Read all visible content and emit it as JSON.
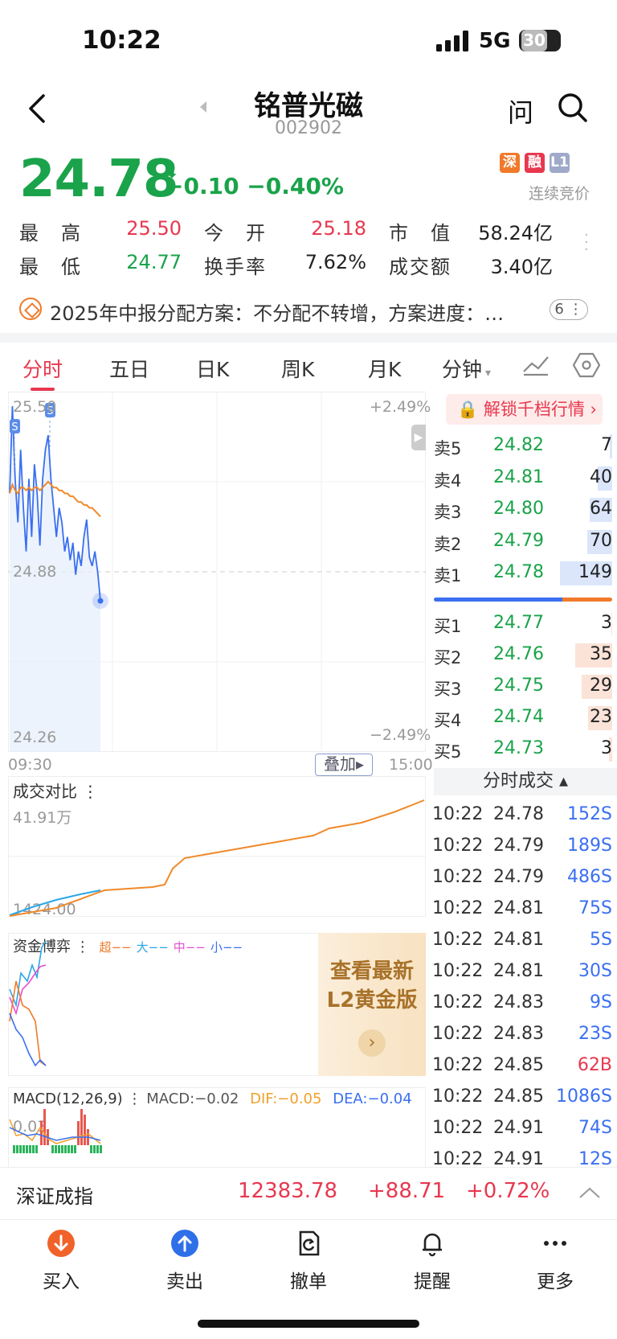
{
  "status": {
    "time": "10:22",
    "network": "5G",
    "battery": "30"
  },
  "header": {
    "name": "铭普光磁",
    "code": "002902",
    "ask_label": "问"
  },
  "quote": {
    "price": "24.78",
    "change": "−0.10",
    "change_pct": "−0.40%",
    "badges": [
      {
        "label": "深",
        "color": "#f07a2a"
      },
      {
        "label": "融",
        "color": "#e8384f"
      },
      {
        "label": "L1",
        "color": "#9fa9c9"
      }
    ],
    "trading_mode": "连续竞价",
    "stats": [
      {
        "label": "最　高",
        "value": "25.50",
        "color": "#e8384f"
      },
      {
        "label": "今　开",
        "value": "25.18",
        "color": "#e8384f"
      },
      {
        "label": "市　值",
        "value": "58.24亿",
        "color": "#222222"
      },
      {
        "label": "最　低",
        "value": "24.77",
        "color": "#1aa34a"
      },
      {
        "label": "换手率",
        "value": "7.62%",
        "color": "#222222"
      },
      {
        "label": "成交额",
        "value": "3.40亿",
        "color": "#222222"
      }
    ]
  },
  "announcement": {
    "text": "2025年中报分配方案：不分配不转增，方案进度：…",
    "count": "6"
  },
  "tabs": [
    "分时",
    "五日",
    "日K",
    "周K",
    "月K",
    "分钟"
  ],
  "chart": {
    "y_top": "25.50",
    "y_mid": "24.88",
    "y_bottom": "24.26",
    "pct_top": "+2.49%",
    "pct_bottom": "−2.49%",
    "time_start": "09:30",
    "time_end": "15:00",
    "overlay_label": "叠加",
    "marker": "S"
  },
  "chart_data": {
    "type": "line",
    "title": "",
    "ylim": [
      24.26,
      25.5
    ],
    "x": [
      "09:30",
      "09:31",
      "09:32",
      "09:33",
      "09:34",
      "09:35",
      "09:36",
      "09:37",
      "09:38",
      "09:39",
      "09:40",
      "09:41",
      "09:42",
      "09:43",
      "09:44",
      "09:45",
      "09:46",
      "09:47",
      "09:48",
      "09:49",
      "09:50",
      "09:52",
      "09:55",
      "09:58",
      "10:00",
      "10:03",
      "10:05",
      "10:08",
      "10:10",
      "10:13",
      "10:15",
      "10:18",
      "10:20",
      "10:22"
    ],
    "series": [
      {
        "values": [
          25.15,
          25.45,
          25.2,
          25.05,
          25.3,
          25.1,
          24.95,
          25.2,
          25.0,
          25.25,
          25.15,
          24.97,
          25.2,
          25.3,
          25.35,
          25.2,
          25.1,
          25.0,
          25.1,
          25.05,
          24.95,
          25.0,
          24.92,
          24.98,
          24.87,
          24.95,
          24.9,
          25.0,
          25.06,
          24.93,
          24.9,
          24.95,
          24.88,
          24.78
        ]
      },
      {
        "values": [
          25.15,
          25.18,
          25.16,
          25.15,
          25.17,
          25.17,
          25.16,
          25.17,
          25.16,
          25.17,
          25.17,
          25.16,
          25.17,
          25.18,
          25.19,
          25.18,
          25.17,
          25.17,
          25.16,
          25.16,
          25.15,
          25.15,
          25.14,
          25.14,
          25.13,
          25.12,
          25.12,
          25.11,
          25.11,
          25.1,
          25.1,
          25.09,
          25.08,
          25.07
        ]
      }
    ]
  },
  "orderbook": {
    "unlock_label": "解锁千档行情",
    "asks": [
      {
        "label": "卖5",
        "price": "24.82",
        "vol": "7",
        "ratio": 0.05
      },
      {
        "label": "卖4",
        "price": "24.81",
        "vol": "40",
        "ratio": 0.27
      },
      {
        "label": "卖3",
        "price": "24.80",
        "vol": "64",
        "ratio": 0.43
      },
      {
        "label": "卖2",
        "price": "24.79",
        "vol": "70",
        "ratio": 0.47
      },
      {
        "label": "卖1",
        "price": "24.78",
        "vol": "149",
        "ratio": 1.0
      }
    ],
    "bids": [
      {
        "label": "买1",
        "price": "24.77",
        "vol": "3",
        "ratio": 0.02
      },
      {
        "label": "买2",
        "price": "24.76",
        "vol": "35",
        "ratio": 0.7
      },
      {
        "label": "买3",
        "price": "24.75",
        "vol": "29",
        "ratio": 0.58
      },
      {
        "label": "买4",
        "price": "24.74",
        "vol": "23",
        "ratio": 0.46
      },
      {
        "label": "买5",
        "price": "24.73",
        "vol": "3",
        "ratio": 0.06
      }
    ],
    "ask_color": "#dbe6fb",
    "bid_color": "#fbe3d8"
  },
  "ticks": {
    "header": "分时成交",
    "rows": [
      {
        "time": "10:22",
        "price": "24.78",
        "vol": "152S",
        "color": "#3a6ff0"
      },
      {
        "time": "10:22",
        "price": "24.79",
        "vol": "189S",
        "color": "#3a6ff0"
      },
      {
        "time": "10:22",
        "price": "24.79",
        "vol": "486S",
        "color": "#3a6ff0"
      },
      {
        "time": "10:22",
        "price": "24.81",
        "vol": "75S",
        "color": "#3a6ff0"
      },
      {
        "time": "10:22",
        "price": "24.81",
        "vol": "5S",
        "color": "#3a6ff0"
      },
      {
        "time": "10:22",
        "price": "24.81",
        "vol": "30S",
        "color": "#3a6ff0"
      },
      {
        "time": "10:22",
        "price": "24.83",
        "vol": "9S",
        "color": "#3a6ff0"
      },
      {
        "time": "10:22",
        "price": "24.83",
        "vol": "23S",
        "color": "#3a6ff0"
      },
      {
        "time": "10:22",
        "price": "24.85",
        "vol": "62B",
        "color": "#e8384f"
      },
      {
        "time": "10:22",
        "price": "24.85",
        "vol": "1086S",
        "color": "#3a6ff0"
      },
      {
        "time": "10:22",
        "price": "24.91",
        "vol": "74S",
        "color": "#3a6ff0"
      },
      {
        "time": "10:22",
        "price": "24.91",
        "vol": "12S",
        "color": "#3a6ff0"
      }
    ]
  },
  "volume_compare": {
    "title": "成交对比",
    "top_value": "41.91万",
    "bottom_value": "1424.00"
  },
  "fund_flow": {
    "title": "资金博弈",
    "legend": [
      {
        "label": "超",
        "color": "#f07a2a"
      },
      {
        "label": "大",
        "color": "#2aa7e8"
      },
      {
        "label": "中",
        "color": "#e84fd0"
      },
      {
        "label": "小",
        "color": "#3a6ff0"
      }
    ]
  },
  "promo": {
    "line1": "查看最新",
    "line2": "L2黄金版"
  },
  "macd": {
    "title": "MACD(12,26,9)",
    "macd": "MACD:−0.02",
    "dif": "DIF:−0.05",
    "dea": "DEA:−0.04",
    "scale": "0.03"
  },
  "index": {
    "name": "深证成指",
    "value": "12383.78",
    "change": "+88.71",
    "pct": "+0.72%"
  },
  "bottom_nav": [
    {
      "label": "买入",
      "icon": "buy-icon"
    },
    {
      "label": "卖出",
      "icon": "sell-icon"
    },
    {
      "label": "撤单",
      "icon": "cancel-order-icon"
    },
    {
      "label": "提醒",
      "icon": "bell-icon"
    },
    {
      "label": "更多",
      "icon": "more-icon"
    }
  ]
}
